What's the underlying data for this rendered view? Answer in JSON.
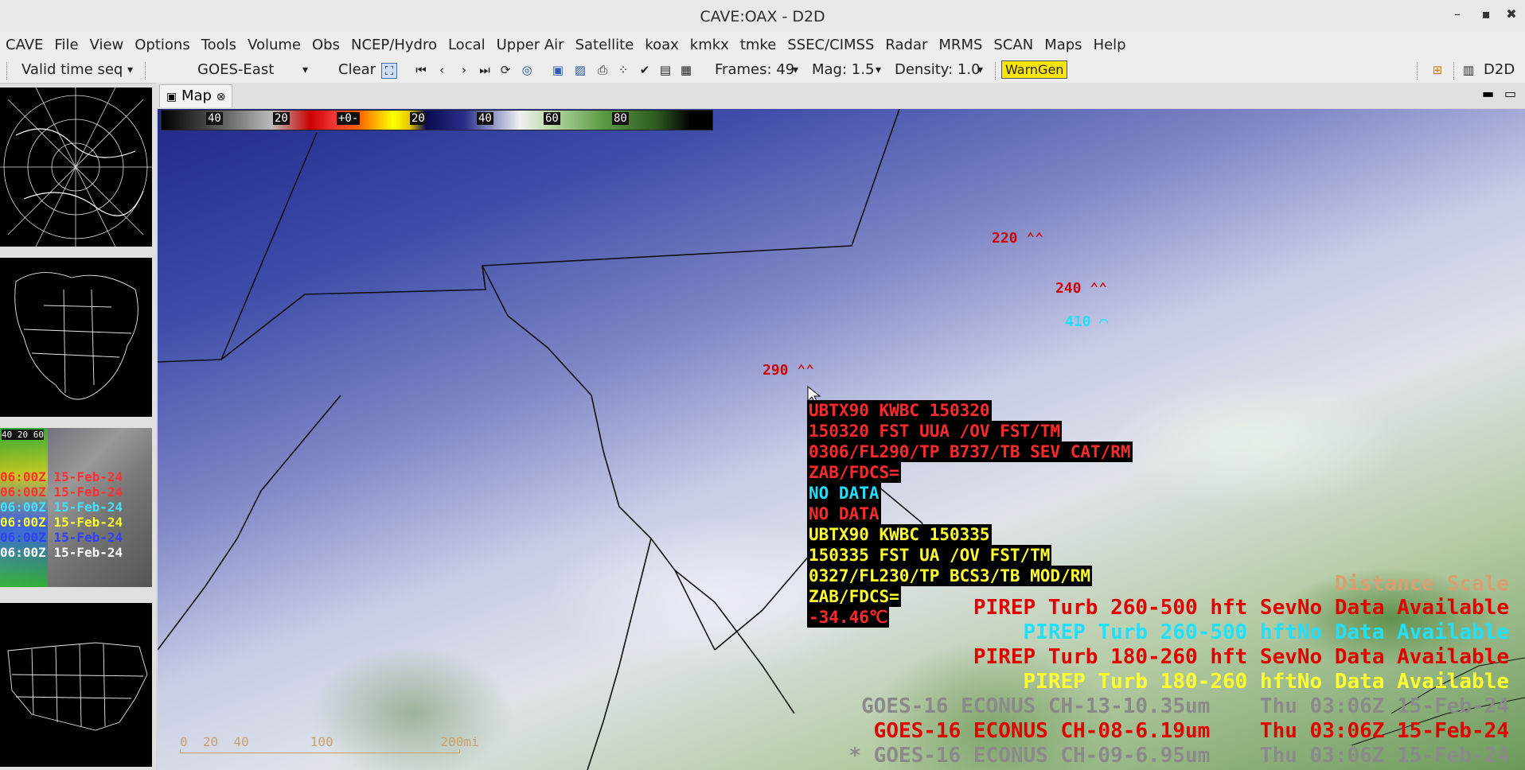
{
  "window": {
    "title": "CAVE:OAX - D2D",
    "min_glyph": "–",
    "max_glyph": "▪",
    "close_glyph": "✖"
  },
  "menu": [
    "CAVE",
    "File",
    "View",
    "Options",
    "Tools",
    "Volume",
    "Obs",
    "NCEP/Hydro",
    "Local",
    "Upper Air",
    "Satellite",
    "koax",
    "kmkx",
    "tmke",
    "SSEC/CIMSS",
    "Radar",
    "MRMS",
    "SCAN",
    "Maps",
    "Help"
  ],
  "toolbar": {
    "time_mode": "Valid time seq",
    "source": "GOES-East",
    "clear": "Clear",
    "frames": "Frames: 49",
    "mag": "Mag: 1.5",
    "density": "Density: 1.0",
    "warngen": "WarnGen",
    "perspective": "D2D",
    "dropdown_glyph": "▾"
  },
  "editor": {
    "tab_label": "Map",
    "tab_close": "⊗"
  },
  "thumbnails": {
    "satellite_times": [
      {
        "text": "06:00Z 15-Feb-24",
        "color": "#ff3030"
      },
      {
        "text": "06:00Z 15-Feb-24",
        "color": "#ff3030"
      },
      {
        "text": "06:00Z 15-Feb-24",
        "color": "#40e0ff"
      },
      {
        "text": "06:00Z 15-Feb-24",
        "color": "#ffff30"
      },
      {
        "text": "06:00Z 15-Feb-24",
        "color": "#3040ff"
      },
      {
        "text": "06:00Z 15-Feb-24",
        "color": "#ffffff"
      }
    ],
    "colorbar_labels": [
      "40",
      "20",
      "60"
    ]
  },
  "colorbar": {
    "labels": [
      "40",
      "20",
      "+0-",
      "20",
      "40",
      "60",
      "80"
    ]
  },
  "pireps": [
    {
      "fl": "220",
      "color": "#d00000"
    },
    {
      "fl": "240",
      "color": "#d00000"
    },
    {
      "fl": "410",
      "color": "#20e0ff"
    },
    {
      "fl": "290",
      "color": "#d00000"
    }
  ],
  "popup": {
    "lines": [
      {
        "text": "UBTX90 KWBC 150320",
        "color": "#ff2a2a"
      },
      {
        "text": "150320 FST UUA /OV FST/TM",
        "color": "#ff2a2a"
      },
      {
        "text": "0306/FL290/TP B737/TB SEV CAT/RM",
        "color": "#ff2a2a"
      },
      {
        "text": "ZAB/FDCS=",
        "color": "#ff2a2a"
      },
      {
        "text": "NO DATA",
        "color": "#20e0ff"
      },
      {
        "text": "NO DATA",
        "color": "#ff2a2a"
      },
      {
        "text": "UBTX90 KWBC 150335",
        "color": "#ffff30"
      },
      {
        "text": "150335 FST UA /OV FST/TM",
        "color": "#ffff30"
      },
      {
        "text": "0327/FL230/TP BCS3/TB MOD/RM",
        "color": "#ffff30"
      },
      {
        "text": "ZAB/FDCS=",
        "color": "#ffff30"
      },
      {
        "text": "-34.46℃",
        "color": "#ff2a2a"
      }
    ]
  },
  "legend": [
    {
      "text": "Distance Scale",
      "color": "#d8a070"
    },
    {
      "text": "PIREP Turb 260-500 hft SevNo Data Available",
      "color": "#e00000"
    },
    {
      "text": "PIREP Turb 260-500 hftNo Data Available",
      "color": "#20e0ff"
    },
    {
      "text": "PIREP Turb 180-260 hft SevNo Data Available",
      "color": "#e00000"
    },
    {
      "text": "PIREP Turb 180-260 hftNo Data Available",
      "color": "#ffff30"
    },
    {
      "text": "GOES-16 ECONUS CH-13-10.35um    Thu 03:06Z 15-Feb-24",
      "color": "#8a8a8a"
    },
    {
      "text": "GOES-16 ECONUS CH-08-6.19um    Thu 03:06Z 15-Feb-24",
      "color": "#e00000"
    },
    {
      "text": "* GOES-16 ECONUS CH-09-6.95um    Thu 03:06Z 15-Feb-24",
      "color": "#8a8a8a"
    }
  ],
  "distance_scale": "0  20  40        100              200mi"
}
